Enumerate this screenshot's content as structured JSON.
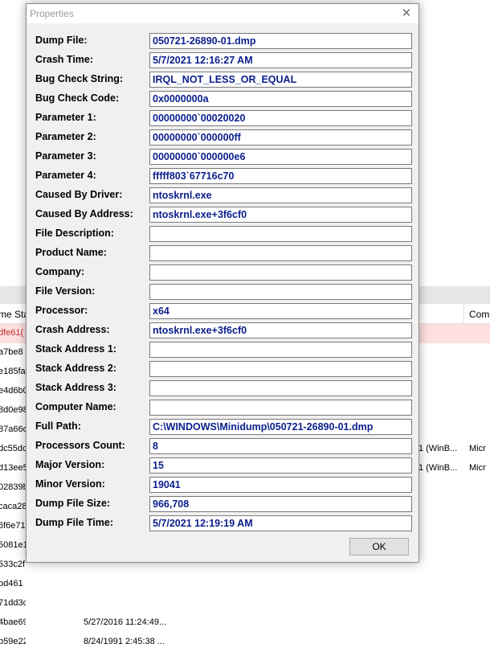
{
  "dialog": {
    "title": "Properties",
    "close_glyph": "✕",
    "ok_label": "OK",
    "fields": [
      {
        "label": "Dump File:",
        "value": "050721-26890-01.dmp"
      },
      {
        "label": "Crash Time:",
        "value": "5/7/2021 12:16:27 AM"
      },
      {
        "label": "Bug Check String:",
        "value": "IRQL_NOT_LESS_OR_EQUAL"
      },
      {
        "label": "Bug Check Code:",
        "value": "0x0000000a"
      },
      {
        "label": "Parameter 1:",
        "value": "00000000`00020020"
      },
      {
        "label": "Parameter 2:",
        "value": "00000000`000000ff"
      },
      {
        "label": "Parameter 3:",
        "value": "00000000`000000e6"
      },
      {
        "label": "Parameter 4:",
        "value": "fffff803`67716c70"
      },
      {
        "label": "Caused By Driver:",
        "value": "ntoskrnl.exe"
      },
      {
        "label": "Caused By Address:",
        "value": "ntoskrnl.exe+3f6cf0"
      },
      {
        "label": "File Description:",
        "value": ""
      },
      {
        "label": "Product Name:",
        "value": ""
      },
      {
        "label": "Company:",
        "value": ""
      },
      {
        "label": "File Version:",
        "value": ""
      },
      {
        "label": "Processor:",
        "value": "x64"
      },
      {
        "label": "Crash Address:",
        "value": "ntoskrnl.exe+3f6cf0"
      },
      {
        "label": "Stack Address 1:",
        "value": ""
      },
      {
        "label": "Stack Address 2:",
        "value": ""
      },
      {
        "label": "Stack Address 3:",
        "value": ""
      },
      {
        "label": "Computer Name:",
        "value": ""
      },
      {
        "label": "Full Path:",
        "value": "C:\\WINDOWS\\Minidump\\050721-26890-01.dmp"
      },
      {
        "label": "Processors Count:",
        "value": "8"
      },
      {
        "label": "Major Version:",
        "value": "15"
      },
      {
        "label": "Minor Version:",
        "value": "19041"
      },
      {
        "label": "Dump File Size:",
        "value": "966,708"
      },
      {
        "label": "Dump File Time:",
        "value": "5/7/2021 12:19:19 AM"
      }
    ]
  },
  "background_list": {
    "column_heads": {
      "name": "me Star",
      "com": "Com"
    },
    "rows": [
      {
        "name": "dfe61(",
        "date": "",
        "ver": "",
        "com": "",
        "selected": true
      },
      {
        "name": "a7be8",
        "date": "",
        "ver": "",
        "com": ""
      },
      {
        "name": "e185fa",
        "date": "",
        "ver": "",
        "com": ""
      },
      {
        "name": "e4d6b0",
        "date": "",
        "ver": "",
        "com": ""
      },
      {
        "name": "8d0e98",
        "date": "",
        "ver": "",
        "com": ""
      },
      {
        "name": "87a66d",
        "date": "",
        "ver": "",
        "com": ""
      },
      {
        "name": "dc55dc",
        "date": "",
        "ver": "1 (WinB...",
        "com": "Micr"
      },
      {
        "name": "d13ee5",
        "date": "",
        "ver": "1 (WinB...",
        "com": "Micr"
      },
      {
        "name": "02839b",
        "date": "",
        "ver": "",
        "com": ""
      },
      {
        "name": "caca28",
        "date": "",
        "ver": "",
        "com": ""
      },
      {
        "name": "6f6e71",
        "date": "",
        "ver": "",
        "com": ""
      },
      {
        "name": "5081e1",
        "date": "",
        "ver": "",
        "com": ""
      },
      {
        "name": "533c2f",
        "date": "",
        "ver": "",
        "com": ""
      },
      {
        "name": "bd461",
        "date": "",
        "ver": "",
        "com": ""
      },
      {
        "name": "71dd3c",
        "date": "",
        "ver": "",
        "com": ""
      },
      {
        "name": "4bae69",
        "date": "5/27/2016 11:24:49...",
        "ver": "",
        "com": ""
      },
      {
        "name": "b59e22",
        "date": "8/24/1991 2:45:38 ...",
        "ver": "",
        "com": ""
      }
    ]
  }
}
